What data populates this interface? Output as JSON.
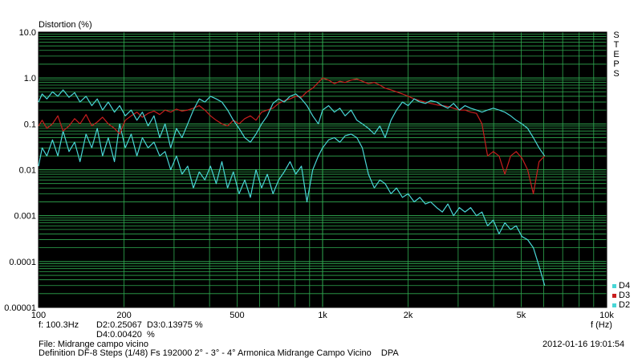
{
  "chart_data": {
    "type": "line",
    "title": "Distortion (%)",
    "xlabel": "f (Hz)",
    "x_scale": "log",
    "y_scale": "log",
    "xlim": [
      100,
      10000
    ],
    "ylim": [
      1e-05,
      10
    ],
    "x_ticks": [
      "100",
      "200",
      "500",
      "1k",
      "2k",
      "5k",
      "10k"
    ],
    "x_tick_values": [
      100,
      200,
      500,
      1000,
      2000,
      5000,
      10000
    ],
    "y_ticks": [
      "10.0",
      "1.0",
      "0.1",
      "0.01",
      "0.001",
      "0.0001",
      "0.00001"
    ],
    "y_tick_values": [
      10,
      1,
      0.1,
      0.01,
      0.001,
      0.0001,
      1e-05
    ],
    "grid": true,
    "background": "#000000",
    "grid_color": "#2fa84f",
    "legend_placement": "right-bottom",
    "side_label": "STEPS",
    "series": [
      {
        "name": "D2",
        "color": "#49d6d6",
        "x": [
          100,
          103,
          107,
          112,
          117,
          122,
          128,
          134,
          140,
          147,
          154,
          161,
          168,
          176,
          185,
          193,
          202,
          212,
          222,
          232,
          243,
          255,
          267,
          279,
          292,
          306,
          320,
          335,
          351,
          368,
          385,
          403,
          422,
          442,
          463,
          485,
          508,
          532,
          557,
          583,
          610,
          639,
          669,
          700,
          733,
          768,
          804,
          842,
          881,
          923,
          966,
          1000,
          1050,
          1100,
          1150,
          1200,
          1260,
          1320,
          1380,
          1450,
          1520,
          1590,
          1660,
          1740,
          1820,
          1910,
          2000,
          2100,
          2200,
          2300,
          2400,
          2520,
          2640,
          2760,
          2890,
          3030,
          3170,
          3320,
          3480,
          3640,
          3810,
          3990,
          4180,
          4380,
          4590,
          4800,
          5030,
          5270,
          5520,
          5780,
          6050
        ],
        "y": [
          0.012,
          0.03,
          0.02,
          0.045,
          0.02,
          0.07,
          0.025,
          0.04,
          0.015,
          0.06,
          0.03,
          0.08,
          0.02,
          0.05,
          0.015,
          0.1,
          0.03,
          0.06,
          0.02,
          0.05,
          0.03,
          0.04,
          0.02,
          0.025,
          0.01,
          0.02,
          0.008,
          0.012,
          0.004,
          0.009,
          0.006,
          0.012,
          0.005,
          0.015,
          0.004,
          0.009,
          0.003,
          0.006,
          0.0025,
          0.01,
          0.004,
          0.008,
          0.003,
          0.006,
          0.009,
          0.015,
          0.008,
          0.012,
          0.002,
          0.01,
          0.02,
          0.03,
          0.045,
          0.05,
          0.04,
          0.055,
          0.06,
          0.05,
          0.03,
          0.008,
          0.004,
          0.006,
          0.005,
          0.003,
          0.004,
          0.0025,
          0.003,
          0.002,
          0.0025,
          0.0018,
          0.002,
          0.0015,
          0.0012,
          0.0018,
          0.001,
          0.0015,
          0.0012,
          0.0015,
          0.001,
          0.0012,
          0.0006,
          0.0008,
          0.0004,
          0.0007,
          0.0005,
          0.0006,
          0.00035,
          0.0003,
          0.0002,
          8e-05,
          3e-05
        ]
      },
      {
        "name": "D3",
        "color": "#c81e1e",
        "x": [
          100,
          103,
          107,
          112,
          117,
          122,
          128,
          134,
          140,
          147,
          154,
          161,
          168,
          176,
          185,
          193,
          202,
          212,
          222,
          232,
          243,
          255,
          267,
          279,
          292,
          306,
          320,
          335,
          351,
          368,
          385,
          403,
          422,
          442,
          463,
          485,
          508,
          532,
          557,
          583,
          610,
          639,
          669,
          700,
          733,
          768,
          804,
          842,
          881,
          923,
          966,
          1000,
          1050,
          1100,
          1150,
          1200,
          1260,
          1320,
          1380,
          1450,
          1520,
          1590,
          1660,
          1740,
          1820,
          1910,
          2000,
          2100,
          2200,
          2300,
          2400,
          2520,
          2640,
          2760,
          2890,
          3030,
          3170,
          3320,
          3480,
          3640,
          3810,
          3990,
          4180,
          4380,
          4590,
          4800,
          5030,
          5270,
          5520,
          5780,
          6050
        ],
        "y": [
          0.09,
          0.12,
          0.08,
          0.1,
          0.15,
          0.07,
          0.09,
          0.13,
          0.1,
          0.16,
          0.09,
          0.11,
          0.14,
          0.1,
          0.08,
          0.06,
          0.12,
          0.15,
          0.18,
          0.14,
          0.17,
          0.19,
          0.16,
          0.2,
          0.18,
          0.21,
          0.19,
          0.2,
          0.22,
          0.25,
          0.2,
          0.15,
          0.12,
          0.1,
          0.09,
          0.12,
          0.1,
          0.13,
          0.15,
          0.12,
          0.18,
          0.2,
          0.22,
          0.28,
          0.32,
          0.35,
          0.4,
          0.38,
          0.5,
          0.6,
          0.8,
          1.0,
          0.9,
          0.75,
          0.85,
          0.8,
          0.9,
          0.95,
          0.85,
          0.75,
          0.8,
          0.7,
          0.6,
          0.55,
          0.5,
          0.45,
          0.4,
          0.35,
          0.32,
          0.3,
          0.28,
          0.26,
          0.25,
          0.24,
          0.22,
          0.2,
          0.2,
          0.18,
          0.17,
          0.1,
          0.02,
          0.025,
          0.02,
          0.008,
          0.02,
          0.025,
          0.018,
          0.01,
          0.003,
          0.015,
          0.02
        ]
      },
      {
        "name": "D4",
        "color": "#49d6d6",
        "x": [
          100,
          103,
          107,
          112,
          117,
          122,
          128,
          134,
          140,
          147,
          154,
          161,
          168,
          176,
          185,
          193,
          202,
          212,
          222,
          232,
          243,
          255,
          267,
          279,
          292,
          306,
          320,
          335,
          351,
          368,
          385,
          403,
          422,
          442,
          463,
          485,
          508,
          532,
          557,
          583,
          610,
          639,
          669,
          700,
          733,
          768,
          804,
          842,
          881,
          923,
          966,
          1000,
          1050,
          1100,
          1150,
          1200,
          1260,
          1320,
          1380,
          1450,
          1520,
          1590,
          1660,
          1740,
          1820,
          1910,
          2000,
          2100,
          2200,
          2300,
          2400,
          2520,
          2640,
          2760,
          2890,
          3030,
          3170,
          3320,
          3480,
          3640,
          3810,
          3990,
          4180,
          4380,
          4590,
          4800,
          5030,
          5270,
          5520,
          5780,
          6050
        ],
        "y": [
          0.3,
          0.45,
          0.35,
          0.5,
          0.4,
          0.55,
          0.38,
          0.48,
          0.3,
          0.4,
          0.25,
          0.35,
          0.2,
          0.3,
          0.18,
          0.25,
          0.15,
          0.2,
          0.12,
          0.18,
          0.09,
          0.15,
          0.05,
          0.1,
          0.03,
          0.08,
          0.05,
          0.1,
          0.2,
          0.35,
          0.3,
          0.4,
          0.35,
          0.3,
          0.2,
          0.12,
          0.08,
          0.05,
          0.04,
          0.06,
          0.1,
          0.15,
          0.28,
          0.35,
          0.3,
          0.4,
          0.45,
          0.35,
          0.25,
          0.15,
          0.1,
          0.2,
          0.25,
          0.18,
          0.22,
          0.15,
          0.2,
          0.12,
          0.1,
          0.08,
          0.06,
          0.09,
          0.05,
          0.12,
          0.2,
          0.3,
          0.25,
          0.35,
          0.3,
          0.28,
          0.32,
          0.3,
          0.25,
          0.22,
          0.28,
          0.2,
          0.25,
          0.22,
          0.2,
          0.18,
          0.2,
          0.22,
          0.2,
          0.18,
          0.15,
          0.12,
          0.1,
          0.08,
          0.05,
          0.03,
          0.02
        ]
      }
    ]
  },
  "readout": {
    "freq": "f: 100.3Hz",
    "d2d3": "D2:0.25067  D3:0.13975 %",
    "d4": "D4:0.00420  %"
  },
  "footer": {
    "file": "File: Midrange campo vicino",
    "definition": "Definition DF-8 Steps (1/48) Fs 192000 2° - 3° - 4° Armonica Midrange Campo Vicino    DPA",
    "timestamp": "2012-01-16 19:01:54"
  },
  "side_letters": [
    "S",
    "T",
    "E",
    "P",
    "S"
  ]
}
